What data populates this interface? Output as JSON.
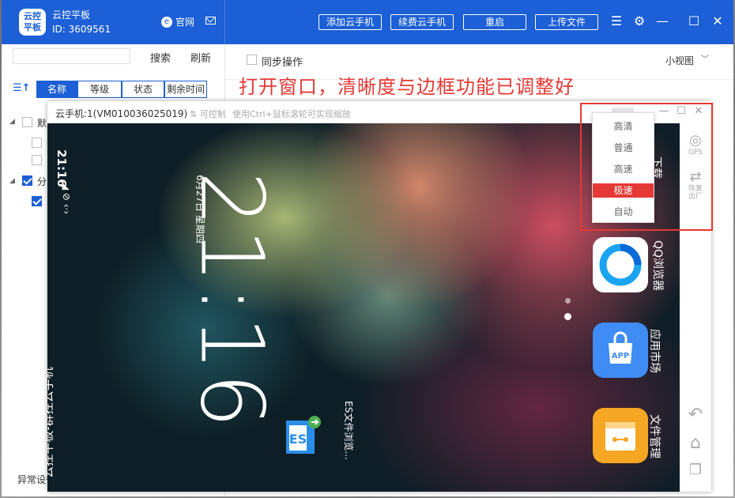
{
  "app": {
    "logo_text": "云控\n平板",
    "title": "云控平板",
    "id_text": "ID: 3609561",
    "official_label": "官网",
    "buttons": [
      "添加云手机",
      "续费云手机",
      "重启",
      "上传文件"
    ]
  },
  "left": {
    "search_label": "搜索",
    "refresh_label": "刷新",
    "columns": [
      "名称",
      "等级",
      "状态",
      "剩余时间"
    ],
    "tree": [
      {
        "label": "默",
        "checked": false
      },
      {
        "label": "",
        "checked": false
      },
      {
        "label": "",
        "checked": false
      },
      {
        "label": "分",
        "checked": true
      },
      {
        "label": "",
        "checked": true
      }
    ],
    "footer": "异常设备"
  },
  "right": {
    "sync_label": "同步操作",
    "view_mode": "小视图",
    "annotation": "打开窗口，清晰度与边框功能已调整好"
  },
  "phone_window": {
    "title": "云手机:1(VM010036025019)",
    "control_label": "可控制",
    "hint": "使用Ctrl+鼠标滚轮可实现缩放"
  },
  "phone_screen": {
    "status_time": "21:16",
    "clock": "21:16",
    "date": "6月27日 星期四",
    "brand": "云控平板-群控云手机",
    "es_label": "ES文件浏览...",
    "apps": [
      {
        "label": "下载",
        "color": "#3da1ff"
      },
      {
        "label": "QQ浏览器",
        "color": "#ffffff"
      },
      {
        "label": "应用市场",
        "color": "#3f8cf5"
      },
      {
        "label": "文件管理",
        "color": "#f5a623"
      }
    ]
  },
  "tools": {
    "gps": "GPS",
    "factory_reset": "恢复出厂"
  },
  "quality_menu": {
    "options": [
      "高清",
      "普通",
      "高速",
      "极速",
      "自动"
    ],
    "selected": "极速"
  }
}
